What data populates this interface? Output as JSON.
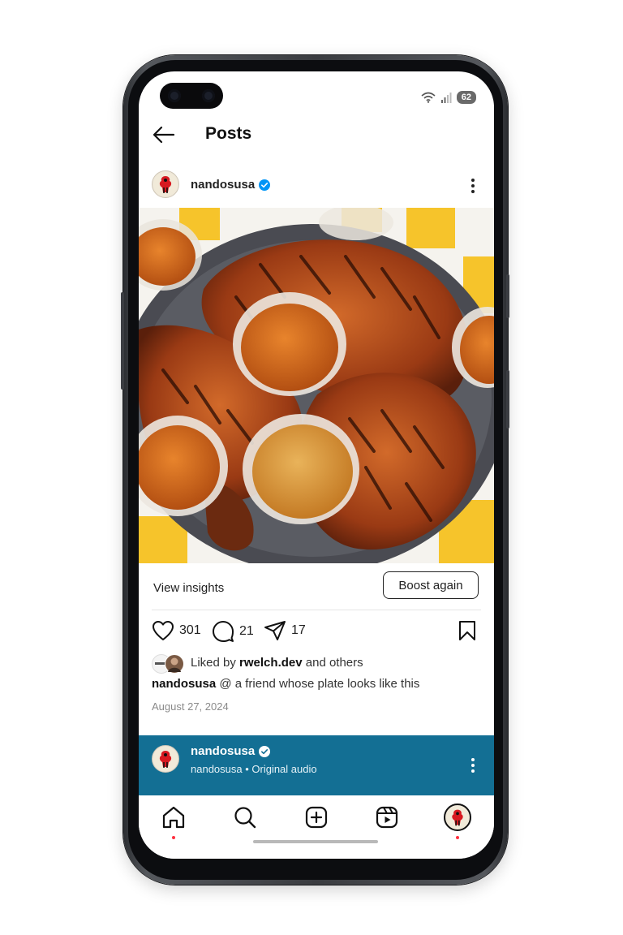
{
  "status_bar": {
    "battery": "62"
  },
  "header": {
    "title": "Posts",
    "back_icon": "arrow-left-icon"
  },
  "post": {
    "username": "nandosusa",
    "verified": true,
    "image_description_icon": "chicken-with-sauces-photo",
    "insights_label": "View insights",
    "boost_label": "Boost again",
    "likes_count": "301",
    "comments_count": "21",
    "shares_count": "17",
    "liked_by_prefix": "Liked by",
    "liked_by_user": "rwelch.dev",
    "liked_by_suffix": "and others",
    "caption_user": "nandosusa",
    "caption_text": "@ a friend whose plate looks like this",
    "date": "August 27, 2024"
  },
  "audio_bar": {
    "username": "nandosusa",
    "subtitle": "nandosusa • Original audio",
    "background": "#136f94"
  },
  "bottom_nav": {
    "items": [
      "home-icon",
      "search-icon",
      "create-icon",
      "reels-icon",
      "profile-avatar"
    ]
  },
  "colors": {
    "verified_blue": "#0095f6",
    "notification_dot": "#ff3040",
    "brand_red": "#d71920"
  }
}
